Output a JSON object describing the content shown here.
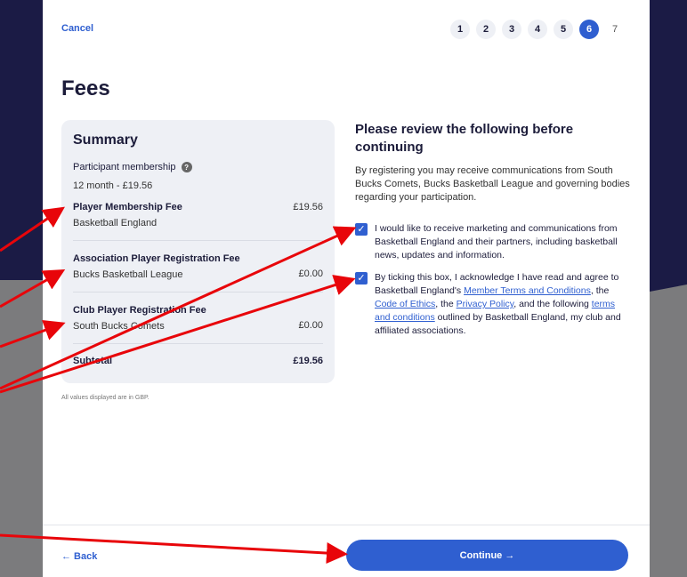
{
  "header": {
    "cancel_label": "Cancel",
    "steps": [
      "1",
      "2",
      "3",
      "4",
      "5",
      "6",
      "7"
    ],
    "active_step": "6"
  },
  "page_title": "Fees",
  "summary": {
    "title": "Summary",
    "membership_label": "Participant membership",
    "membership_detail": "12 month - £19.56",
    "fees": [
      {
        "name": "Player Membership Fee",
        "org": "Basketball England",
        "amount": "£19.56"
      },
      {
        "name": "Association Player Registration Fee",
        "org": "Bucks Basketball League",
        "amount": "£0.00"
      },
      {
        "name": "Club Player Registration Fee",
        "org": "South Bucks Comets",
        "amount": "£0.00"
      }
    ],
    "subtotal_label": "Subtotal",
    "subtotal_amount": "£19.56"
  },
  "note": "All values displayed are in GBP.",
  "review": {
    "title": "Please review the following before continuing",
    "intro": "By registering you may receive communications from South Bucks Comets, Bucks Basketball League and governing bodies regarding your participation.",
    "marketing_text": "I would like to receive marketing and communications from Basketball England and their partners, including basketball news, updates and information.",
    "terms": {
      "part1": "By ticking this box, I acknowledge I have read and agree to Basketball England's ",
      "link1": "Member Terms and Conditions",
      "part2": ", the ",
      "link2": "Code of Ethics",
      "part3": ", the ",
      "link3": "Privacy Policy",
      "part4": ", and the following ",
      "link4": "terms and conditions",
      "part5": " outlined by Basketball England, my club and affiliated associations."
    }
  },
  "footer": {
    "back_label": "← Back",
    "continue_label": "Continue →"
  },
  "colors": {
    "accent": "#2f5fd0",
    "navy": "#1b1b45",
    "annotation": "#e8050a"
  }
}
